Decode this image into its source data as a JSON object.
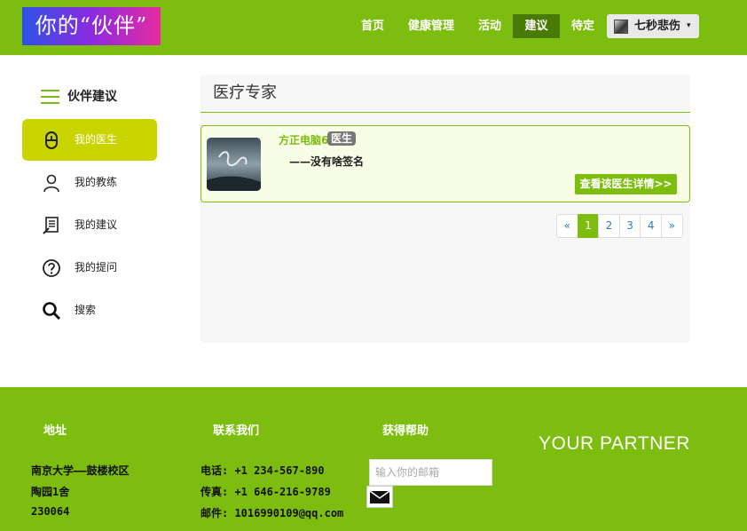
{
  "header": {
    "logo": "你的“伙伴”",
    "nav": [
      {
        "label": "首页",
        "active": false
      },
      {
        "label": "健康管理",
        "active": false
      },
      {
        "label": "活动",
        "active": false
      },
      {
        "label": "建议",
        "active": true
      },
      {
        "label": "待定",
        "active": false
      }
    ],
    "user_name": "七秒悲伤",
    "caret": "▾"
  },
  "sidebar": {
    "title": "伙伴建议",
    "items": [
      {
        "label": "我的医生",
        "icon": "doctor-icon",
        "active": true
      },
      {
        "label": "我的教练",
        "icon": "coach-icon",
        "active": false
      },
      {
        "label": "我的建议",
        "icon": "advice-icon",
        "active": false
      },
      {
        "label": "我的提问",
        "icon": "question-icon",
        "active": false
      },
      {
        "label": "搜索",
        "icon": "search-icon",
        "active": false
      }
    ]
  },
  "main": {
    "title": "医疗专家",
    "card": {
      "name": "方正电脑6",
      "tag": "医生",
      "signature": "——没有啥签名",
      "detail_button": "查看该医生详情>>"
    },
    "pager": {
      "prev": "«",
      "pages": [
        "1",
        "2",
        "3",
        "4"
      ],
      "current": "1",
      "next": "»"
    }
  },
  "footer": {
    "address": {
      "heading": "地址",
      "lines": [
        "南京大学——鼓楼校区",
        "陶园1舍",
        "230064"
      ]
    },
    "contact": {
      "heading": "联系我们",
      "lines": [
        "电话: +1 234-567-890",
        "传真: +1 646-216-9789",
        "邮件: 1016990109@qq.com"
      ]
    },
    "help": {
      "heading": "获得帮助",
      "email_placeholder": "输入你的邮箱"
    },
    "brand": "YOUR PARTNER"
  },
  "colors": {
    "accent": "#7dbd0f",
    "nav_active": "#4a7a06",
    "sidebar_active": "#c9d400",
    "pager_active": "#7dbd0f",
    "tag_bg": "#777777"
  }
}
